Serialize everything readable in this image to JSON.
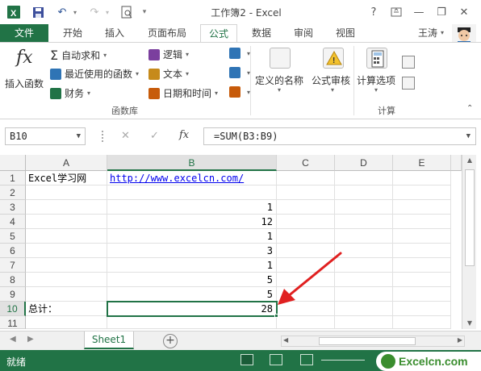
{
  "window": {
    "title": "工作簿2 - Excel",
    "help_label": "?",
    "min_label": "—",
    "restore_label": "❐",
    "close_label": "✕"
  },
  "quick_access": {
    "save_icon": "save-icon",
    "undo_icon": "undo-icon",
    "redo_icon": "redo-icon",
    "preview_icon": "print-preview-icon"
  },
  "tabs": {
    "file": "文件",
    "items": [
      "开始",
      "插入",
      "页面布局",
      "公式",
      "数据",
      "审阅",
      "视图"
    ],
    "active": "公式",
    "user": "王涛"
  },
  "ribbon": {
    "insert_function": "插入函数",
    "autosum": "自动求和",
    "recent": "最近使用的函数",
    "financial": "财务",
    "logical": "逻辑",
    "text": "文本",
    "datetime": "日期和时间",
    "group_funclib": "函数库",
    "defined_names": "定义的名称",
    "formula_audit": "公式审核",
    "calc_options": "计算选项",
    "group_calc": "计算",
    "colors": {
      "accent": "#217346",
      "logical": "#7b3f9e",
      "text": "#c68a1b",
      "datetime": "#c75b0a",
      "lookup": "#2f74b5"
    }
  },
  "formula_bar": {
    "name_box": "B10",
    "cancel": "✕",
    "enter": "✓",
    "fx": "fx",
    "formula": "=SUM(B3:B9)"
  },
  "sheet": {
    "columns": [
      "A",
      "B",
      "C",
      "D",
      "E"
    ],
    "selected_column": "B",
    "rows": [
      "1",
      "2",
      "3",
      "4",
      "5",
      "6",
      "7",
      "8",
      "9",
      "10",
      "11"
    ],
    "selected_row": "10",
    "cells": {
      "A1": "Excel学习网",
      "B1": "http://www.excelcn.com/",
      "B3": "1",
      "B4": "12",
      "B5": "1",
      "B6": "3",
      "B7": "1",
      "B8": "5",
      "B9": "5",
      "A10": "总计：",
      "B10": "28"
    },
    "active_cell": "B10"
  },
  "sheet_tabs": {
    "items": [
      "Sheet1"
    ],
    "add_label": "+"
  },
  "status_bar": {
    "text": "就绪",
    "brand": "Excelcn.com"
  }
}
